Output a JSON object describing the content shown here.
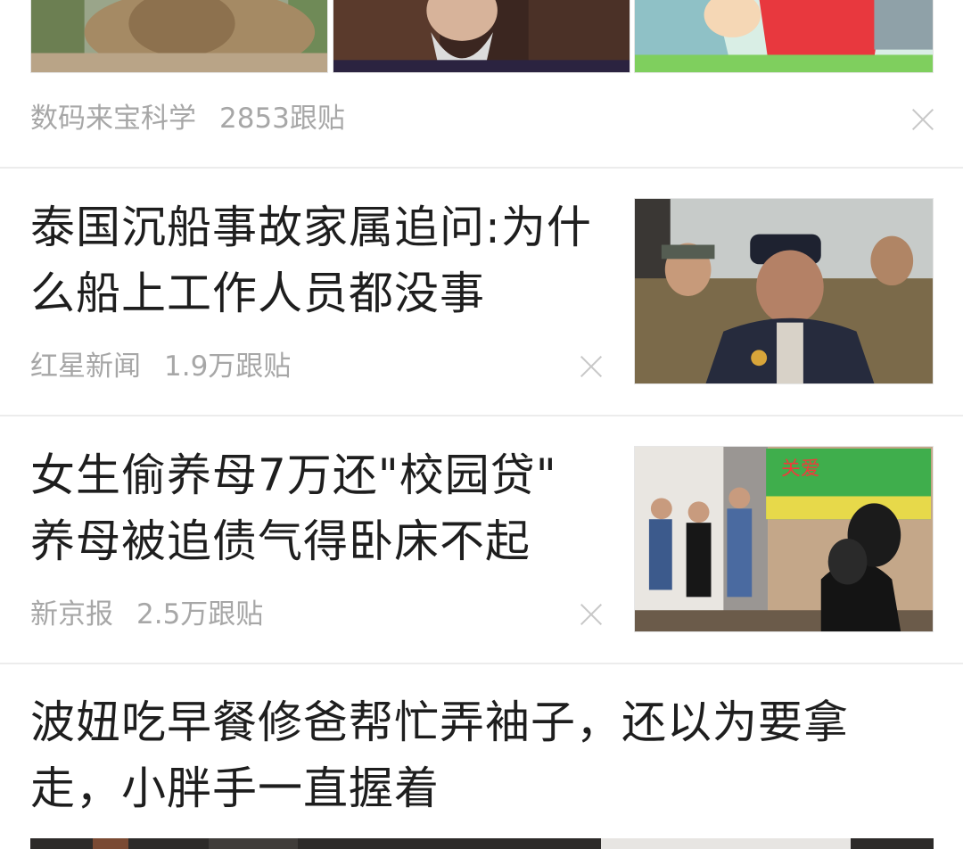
{
  "feed": {
    "item0": {
      "source": "数码来宝科学",
      "comments": "2853跟贴"
    },
    "item1": {
      "title_line1": "泰国沉船事故家属追问:为什",
      "title_line2": "么船上工作人员都没事",
      "source": "红星新闻",
      "comments": "1.9万跟贴"
    },
    "item2": {
      "title_line1": "女生偷养母7万还\"校园贷\"",
      "title_line2": "养母被追债气得卧床不起",
      "source": "新京报",
      "comments": "2.5万跟贴",
      "image_sign_text": "关爱"
    },
    "item3": {
      "title_line1": "波妞吃早餐修爸帮忙弄袖子，还以为要拿",
      "title_line2": "走，小胖手一直握着"
    }
  },
  "icons": {
    "dismiss": "close-icon"
  },
  "colors": {
    "meta_text": "#a7a7a7",
    "divider": "#ececec",
    "title_text": "#1e1e1e"
  }
}
